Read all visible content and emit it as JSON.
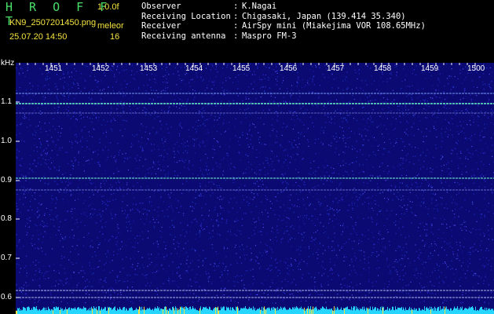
{
  "header": {
    "app_name": "H R O F F T",
    "version": "1.0.0f",
    "file_name": "KN9_2507201450.png",
    "flag": "meleor",
    "datetime": "25.07.20 14:50",
    "count": "16",
    "info": [
      {
        "key": "Observer",
        "colon": ":",
        "value": "K.Nagai"
      },
      {
        "key": "Receiving Location",
        "colon": ":",
        "value": "Chigasaki, Japan (139.414 35.340)"
      },
      {
        "key": "Receiver",
        "colon": ":",
        "value": "AirSpy mini (Miakejima VOR 108.65MHz)"
      },
      {
        "key": "Receiving antenna",
        "colon": ":",
        "value": "Maspro FM-3"
      }
    ]
  },
  "y_axis": {
    "unit": "kHz",
    "ticks": [
      "1.1",
      "1.0",
      "0.9",
      "0.8",
      "0.7",
      "0.6"
    ]
  },
  "x_axis": {
    "ticks": [
      "1451",
      "1452",
      "1453",
      "1454",
      "1455",
      "1456",
      "1457",
      "1458",
      "1459",
      "1500"
    ]
  },
  "colors": {
    "background": "#000000",
    "spectrogram_base": "#0a0a72",
    "carrier_line": "#6fffd2",
    "title_green": "#49e06a",
    "label_yellow": "#f3e241"
  }
}
